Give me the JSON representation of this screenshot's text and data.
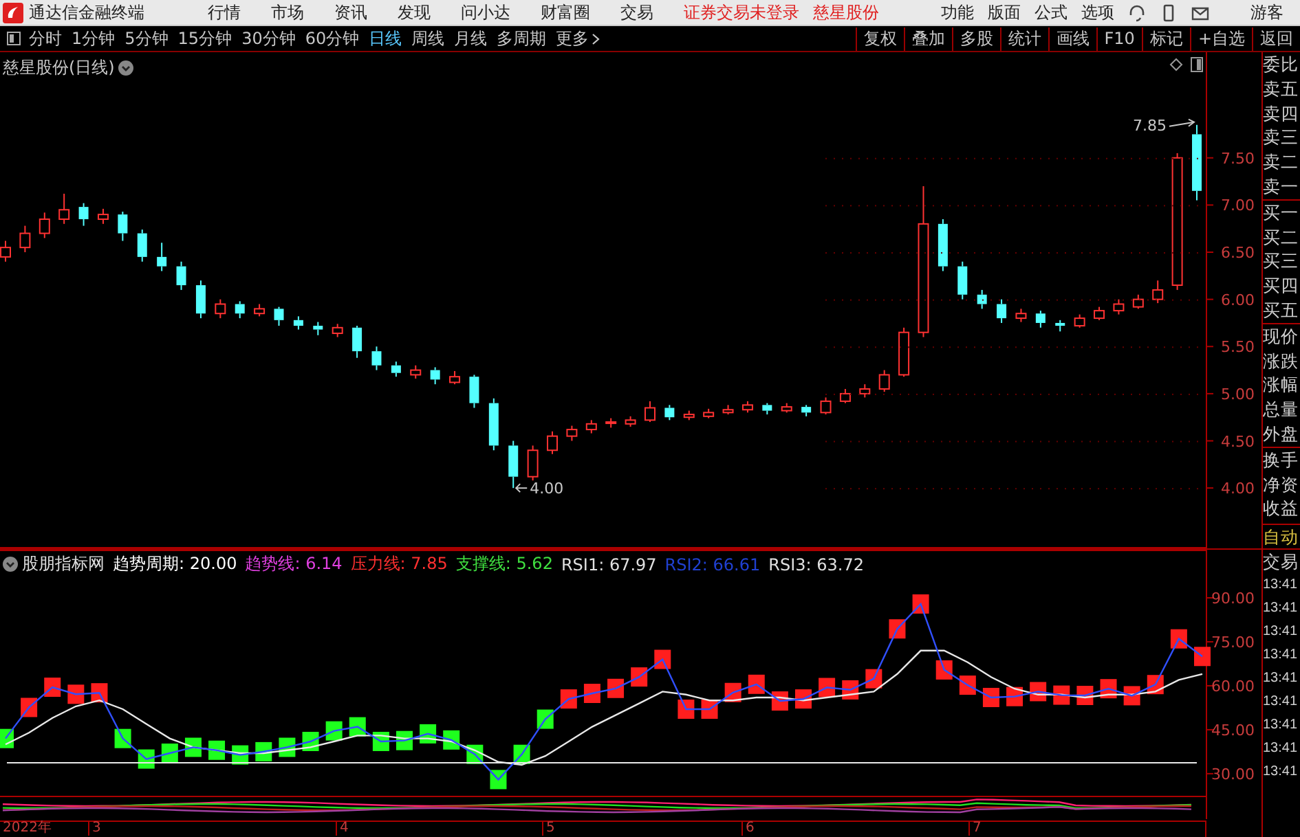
{
  "app": {
    "title": "通达信金融终端",
    "menu": [
      "行情",
      "市场",
      "资讯",
      "发现",
      "问小达",
      "财富圈",
      "交易"
    ],
    "notice": "证券交易未登录",
    "stock_link": "慈星股份",
    "right_menu": [
      "功能",
      "版面",
      "公式",
      "选项"
    ],
    "user": "游客"
  },
  "period_tabs": [
    {
      "label": "分时",
      "selected": false
    },
    {
      "label": "1分钟",
      "selected": false
    },
    {
      "label": "5分钟",
      "selected": false
    },
    {
      "label": "15分钟",
      "selected": false
    },
    {
      "label": "30分钟",
      "selected": false
    },
    {
      "label": "60分钟",
      "selected": false
    },
    {
      "label": "日线",
      "selected": true
    },
    {
      "label": "周线",
      "selected": false
    },
    {
      "label": "月线",
      "selected": false
    },
    {
      "label": "多周期",
      "selected": false
    }
  ],
  "more": "更多",
  "date_axis": [
    "2022年",
    "3",
    "4",
    "5",
    "6",
    "7"
  ],
  "chart_tools": [
    "复权",
    "叠加",
    "多股",
    "统计",
    "画线",
    "F10",
    "标记",
    "+自选",
    "返回"
  ],
  "price_chart": {
    "title": "慈星股份(日线)",
    "high_label": "7.85",
    "low_label": "4.00",
    "chart_data": {
      "type": "candlestick",
      "ylim": [
        3.36,
        8.62
      ],
      "yticks": [
        {
          "value": 7.5,
          "label": "7.50"
        },
        {
          "value": 7,
          "label": "7.00"
        },
        {
          "value": 6.5,
          "label": "6.50"
        },
        {
          "value": 6,
          "label": "6.00"
        },
        {
          "value": 5.5,
          "label": "5.50"
        },
        {
          "value": 5,
          "label": "5.00"
        },
        {
          "value": 4.5,
          "label": "4.50"
        },
        {
          "value": 4,
          "label": "4.00"
        }
      ],
      "ohlc": [
        [
          6.45,
          6.62,
          6.4,
          6.55
        ],
        [
          6.55,
          6.78,
          6.5,
          6.7
        ],
        [
          6.7,
          6.92,
          6.65,
          6.85
        ],
        [
          6.85,
          7.12,
          6.8,
          6.95
        ],
        [
          6.98,
          7.02,
          6.78,
          6.85
        ],
        [
          6.85,
          6.96,
          6.8,
          6.9
        ],
        [
          6.9,
          6.93,
          6.62,
          6.7
        ],
        [
          6.7,
          6.74,
          6.4,
          6.45
        ],
        [
          6.45,
          6.6,
          6.3,
          6.35
        ],
        [
          6.35,
          6.4,
          6.1,
          6.15
        ],
        [
          6.15,
          6.2,
          5.8,
          5.85
        ],
        [
          5.85,
          6.0,
          5.8,
          5.95
        ],
        [
          5.95,
          5.98,
          5.8,
          5.85
        ],
        [
          5.85,
          5.95,
          5.82,
          5.9
        ],
        [
          5.9,
          5.92,
          5.72,
          5.78
        ],
        [
          5.78,
          5.82,
          5.68,
          5.72
        ],
        [
          5.72,
          5.76,
          5.62,
          5.68
        ],
        [
          5.64,
          5.74,
          5.6,
          5.7
        ],
        [
          5.7,
          5.72,
          5.38,
          5.45
        ],
        [
          5.45,
          5.5,
          5.25,
          5.3
        ],
        [
          5.3,
          5.34,
          5.18,
          5.22
        ],
        [
          5.2,
          5.3,
          5.16,
          5.25
        ],
        [
          5.25,
          5.28,
          5.1,
          5.15
        ],
        [
          5.12,
          5.24,
          5.1,
          5.18
        ],
        [
          5.18,
          5.2,
          4.85,
          4.9
        ],
        [
          4.9,
          4.95,
          4.4,
          4.45
        ],
        [
          4.45,
          4.5,
          4.0,
          4.12
        ],
        [
          4.12,
          4.45,
          4.08,
          4.4
        ],
        [
          4.4,
          4.6,
          4.36,
          4.55
        ],
        [
          4.55,
          4.66,
          4.5,
          4.62
        ],
        [
          4.62,
          4.72,
          4.58,
          4.68
        ],
        [
          4.7,
          4.74,
          4.64,
          4.7
        ],
        [
          4.68,
          4.76,
          4.65,
          4.72
        ],
        [
          4.72,
          4.92,
          4.7,
          4.85
        ],
        [
          4.85,
          4.88,
          4.72,
          4.75
        ],
        [
          4.75,
          4.82,
          4.72,
          4.78
        ],
        [
          4.76,
          4.84,
          4.74,
          4.8
        ],
        [
          4.8,
          4.88,
          4.78,
          4.83
        ],
        [
          4.83,
          4.92,
          4.8,
          4.88
        ],
        [
          4.88,
          4.9,
          4.78,
          4.82
        ],
        [
          4.82,
          4.9,
          4.8,
          4.86
        ],
        [
          4.86,
          4.88,
          4.76,
          4.8
        ],
        [
          4.8,
          4.96,
          4.78,
          4.92
        ],
        [
          4.92,
          5.05,
          4.9,
          5.0
        ],
        [
          5.0,
          5.1,
          4.96,
          5.05
        ],
        [
          5.05,
          5.25,
          5.02,
          5.2
        ],
        [
          5.2,
          5.7,
          5.18,
          5.65
        ],
        [
          5.65,
          7.2,
          5.6,
          6.8
        ],
        [
          6.8,
          6.85,
          6.3,
          6.35
        ],
        [
          6.35,
          6.4,
          6.0,
          6.05
        ],
        [
          6.05,
          6.1,
          5.9,
          5.95
        ],
        [
          5.95,
          6.0,
          5.75,
          5.8
        ],
        [
          5.8,
          5.9,
          5.76,
          5.85
        ],
        [
          5.85,
          5.88,
          5.7,
          5.75
        ],
        [
          5.75,
          5.78,
          5.66,
          5.72
        ],
        [
          5.72,
          5.84,
          5.7,
          5.8
        ],
        [
          5.8,
          5.92,
          5.78,
          5.88
        ],
        [
          5.88,
          6.0,
          5.84,
          5.95
        ],
        [
          5.92,
          6.05,
          5.9,
          6.0
        ],
        [
          6.0,
          6.2,
          5.96,
          6.1
        ],
        [
          6.15,
          7.55,
          6.1,
          7.5
        ],
        [
          7.75,
          7.85,
          7.05,
          7.15
        ]
      ]
    }
  },
  "indicator": {
    "items": [
      {
        "text": "股朋指标网",
        "color": "#e0e0e0"
      },
      {
        "text": "趋势周期: 20.00",
        "color": "#ffffff"
      },
      {
        "text": "趋势线: 6.14",
        "color": "#e040e0"
      },
      {
        "text": "压力线: 7.85",
        "color": "#ff3030"
      },
      {
        "text": "支撑线: 5.62",
        "color": "#40e040"
      },
      {
        "text": "RSI1: 67.97",
        "color": "#e0e0e0"
      },
      {
        "text": "RSI2: 66.61",
        "color": "#2040d0"
      },
      {
        "text": "RSI3: 63.72",
        "color": "#e0e0e0"
      }
    ],
    "chart_data": {
      "type": "line",
      "ylim": [
        22,
        106.4
      ],
      "yticks": [
        {
          "value": 90,
          "label": "90.00"
        },
        {
          "value": 75,
          "label": "75.00"
        },
        {
          "value": 60,
          "label": "60.00"
        },
        {
          "value": 45,
          "label": "45.00"
        },
        {
          "value": 30,
          "label": "30.00"
        }
      ],
      "series": [
        {
          "color": "#3050ff",
          "marker": "square",
          "values": [
            42,
            52.6,
            59.5,
            57.1,
            57.6,
            42,
            35,
            37,
            39,
            38,
            36.4,
            37.5,
            39,
            41,
            44.6,
            46,
            41,
            41.3,
            43.6,
            41.5,
            36.6,
            28,
            36.6,
            48.6,
            55.5,
            57.4,
            59.1,
            63,
            69,
            52,
            52,
            57.7,
            60.5,
            54.8,
            55.5,
            59.4,
            58.6,
            62.4,
            79.4,
            87.9,
            65.4,
            60.2,
            56,
            56.3,
            58,
            56.8,
            56.7,
            59,
            56.6,
            60.4,
            76,
            70
          ]
        },
        {
          "color": "#e8e8e8",
          "values": [
            40,
            44,
            49,
            53,
            55,
            52,
            47,
            42,
            39,
            38,
            37,
            37,
            38,
            39,
            41,
            43,
            43,
            42,
            42,
            41,
            38,
            34,
            33,
            36,
            41,
            46,
            50,
            54,
            58,
            57,
            55,
            55,
            56,
            56,
            55,
            56,
            57,
            58,
            64,
            72,
            72,
            68,
            63,
            59,
            57,
            57,
            56,
            57,
            57,
            58,
            62,
            64
          ]
        }
      ]
    }
  },
  "quote_panel": {
    "labels": [
      "委比",
      "卖五",
      "卖四",
      "卖三",
      "卖二",
      "卖一",
      "买一",
      "买二",
      "买三",
      "买四",
      "买五",
      "现价",
      "涨跌",
      "涨幅",
      "总量",
      "外盘",
      "换手",
      "净资",
      "收益"
    ],
    "mode": "自动",
    "trade": "交易",
    "times": [
      "13:41",
      "13:41",
      "13:41",
      "13:41",
      "13:41",
      "13:41",
      "13:41",
      "13:41",
      "13:41"
    ]
  }
}
